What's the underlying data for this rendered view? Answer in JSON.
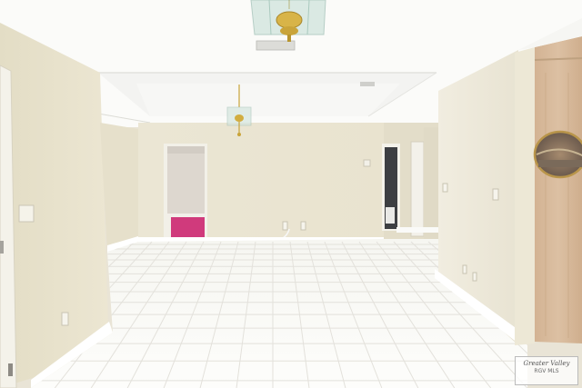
{
  "scene": {
    "subject": "empty-interior-room",
    "colors": {
      "ceiling": "#fbfbf9",
      "wall": "#ebe6d3",
      "floor_tile": "#fbfbf7",
      "grout": "#e6e4df",
      "baseboard": "#ffffff",
      "pink_carpet": "#d03a7c",
      "wood_door": "#d7b99a",
      "chandelier_glass": "#cfe3dc",
      "brass": "#c9a43a"
    }
  },
  "watermark": {
    "logo_text": "Greater Valley",
    "sub_text": "RGV MLS"
  }
}
